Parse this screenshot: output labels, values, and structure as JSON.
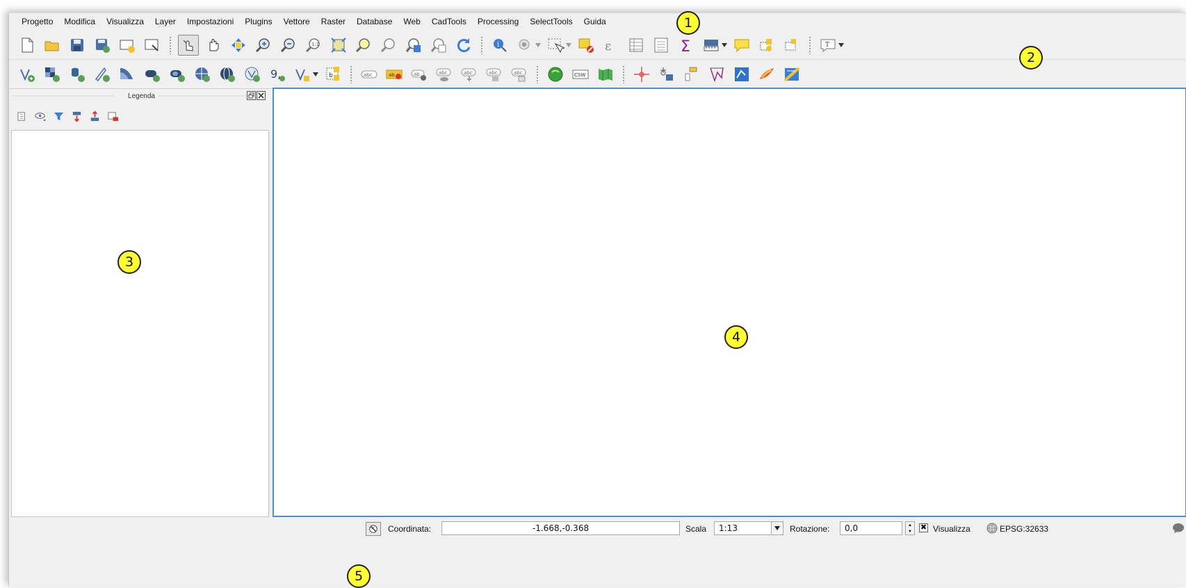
{
  "menubar": {
    "items": [
      "Progetto",
      "Modifica",
      "Visualizza",
      "Layer",
      "Impostazioni",
      "Plugins",
      "Vettore",
      "Raster",
      "Database",
      "Web",
      "CadTools",
      "Processing",
      "SelectTools",
      "Guida"
    ]
  },
  "toolbar_icons_row1": [
    "new-project-icon",
    "open-project-icon",
    "save-project-icon",
    "save-as-icon",
    "new-print-composer-icon",
    "composer-manager-icon",
    "touch-pan-icon",
    "pan-icon",
    "pan-to-selection-icon",
    "zoom-in-icon",
    "zoom-out-icon",
    "zoom-actual-size-icon",
    "zoom-full-icon",
    "zoom-to-selection-icon",
    "zoom-to-layer-icon",
    "zoom-last-icon",
    "zoom-next-icon",
    "refresh-icon",
    "identify-icon",
    "run-action-icon",
    "select-features-icon",
    "deselect-icon",
    "select-by-expression-icon",
    "attribute-table-icon",
    "field-calculator-icon",
    "statistics-icon",
    "measure-icon",
    "map-tips-icon",
    "new-bookmark-icon",
    "show-bookmarks-icon",
    "text-annotation-icon"
  ],
  "toolbar_icons_row2": [
    "add-vector-layer-icon",
    "add-raster-layer-icon",
    "add-postgis-layer-icon",
    "add-spatialite-layer-icon",
    "add-mssql-layer-icon",
    "add-oracle-layer-icon",
    "add-db2-layer-icon",
    "add-wms-layer-icon",
    "add-wcs-layer-icon",
    "add-wfs-layer-icon",
    "add-delimited-text-icon",
    "new-vector-layer-icon",
    "add-virtual-layer-icon",
    "label-toolbar-icon",
    "layer-labeling-icon",
    "pin-labels-icon",
    "show-hide-labels-icon",
    "move-label-icon",
    "rotate-label-icon",
    "change-label-icon",
    "openlayers-icon",
    "csw-icon",
    "metasearch-icon",
    "georeferencer-icon",
    "coordinate-capture-icon",
    "geometry-checker-icon",
    "topology-checker-icon",
    "road-graph-icon",
    "heatmap-icon",
    "interpolation-icon"
  ],
  "legend": {
    "title": "Legenda",
    "tool_icons": [
      "add-group-icon",
      "manage-visibility-icon",
      "filter-legend-icon",
      "expand-all-icon",
      "collapse-all-icon",
      "remove-layer-icon"
    ]
  },
  "statusbar": {
    "coord_label": "Coordinata:",
    "coord_value": "-1.668,-0.368",
    "scale_label": "Scala",
    "scale_value": "1:13",
    "rotation_label": "Rotazione:",
    "rotation_value": "0,0",
    "render_label": "Visualizza",
    "render_checked": true,
    "checkbox_mark": "✖",
    "crs": "EPSG:32633"
  },
  "callouts": [
    "1",
    "2",
    "3",
    "4",
    "5"
  ],
  "colors": {
    "callout_fill": "#ffff33",
    "map_canvas_border": "#4a90d9",
    "background": "#f0f0f0"
  }
}
